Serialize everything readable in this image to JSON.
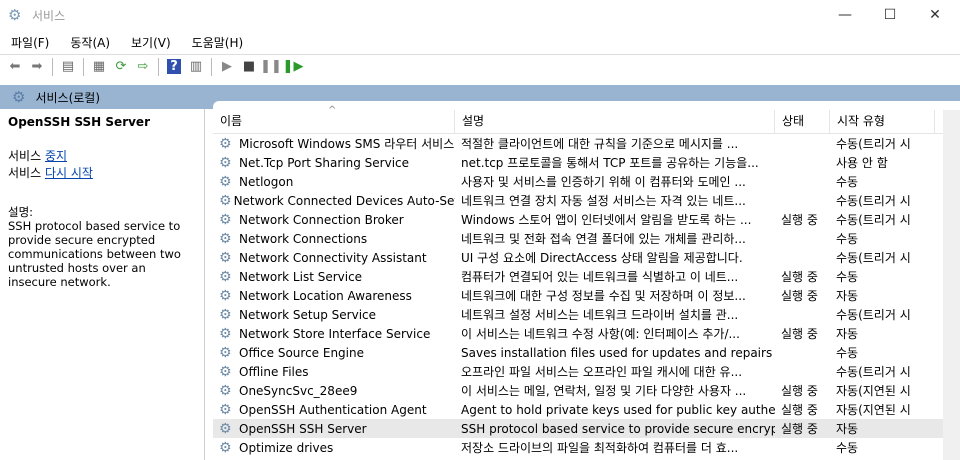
{
  "window": {
    "title": "서비스",
    "icon": "gear-icon"
  },
  "menu": [
    "파일(F)",
    "동작(A)",
    "보기(V)",
    "도움말(H)"
  ],
  "toolbar": [
    "back-icon",
    "forward-icon",
    "show-hide-tree-icon",
    "properties-icon",
    "refresh-icon",
    "export-icon",
    "help-icon",
    "console-icon",
    "start-icon",
    "stop-icon",
    "pause-icon",
    "restart-icon"
  ],
  "scope": {
    "title": "서비스(로컬)"
  },
  "detail": {
    "name": "OpenSSH SSH Server",
    "line1_prefix": "서비스 ",
    "stop_link": "중지",
    "line2_prefix": "서비스 ",
    "restart_link": "다시 시작",
    "desc_label": "설명:",
    "desc": "SSH protocol based service to provide secure encrypted communications between two untrusted hosts over an insecure network."
  },
  "table": {
    "columns": [
      "이름",
      "설명",
      "상태",
      "시작 유형"
    ],
    "rows": [
      {
        "name": "Microsoft Windows SMS 라우터 서비스",
        "desc": "적절한 클라이언트에 대한 규칙을 기준으로 메시지를 ...",
        "status": "",
        "startup": "수동(트리거 시"
      },
      {
        "name": "Net.Tcp Port Sharing Service",
        "desc": "net.tcp 프로토콜을 통해서 TCP 포트를 공유하는 기능을...",
        "status": "",
        "startup": "사용 안 함"
      },
      {
        "name": "Netlogon",
        "desc": "사용자 및 서비스를 인증하기 위해 이 컴퓨터와 도메인 ...",
        "status": "",
        "startup": "수동"
      },
      {
        "name": "Network Connected Devices Auto-Set",
        "desc": "네트워크 연결 장치 자동 설정 서비스는 자격 있는 네트...",
        "status": "",
        "startup": "수동(트리거 시"
      },
      {
        "name": "Network Connection Broker",
        "desc": "Windows 스토어 앱이 인터넷에서 알림을 받도록 하는 ...",
        "status": "실행 중",
        "startup": "수동(트리거 시"
      },
      {
        "name": "Network Connections",
        "desc": "네트워크 및 전화 접속 연결 폴더에 있는 개체를 관리하...",
        "status": "",
        "startup": "수동"
      },
      {
        "name": "Network Connectivity Assistant",
        "desc": "UI 구성 요소에 DirectAccess 상태 알림을 제공합니다.",
        "status": "",
        "startup": "수동(트리거 시"
      },
      {
        "name": "Network List Service",
        "desc": "컴퓨터가 연결되어 있는 네트워크를 식별하고 이 네트...",
        "status": "실행 중",
        "startup": "수동"
      },
      {
        "name": "Network Location Awareness",
        "desc": "네트워크에 대한 구성 정보를 수집 및 저장하며 이 정보...",
        "status": "실행 중",
        "startup": "자동"
      },
      {
        "name": "Network Setup Service",
        "desc": "네트워크 설정 서비스는 네트워크 드라이버 설치를 관...",
        "status": "",
        "startup": "수동(트리거 시"
      },
      {
        "name": "Network Store Interface Service",
        "desc": "이 서비스는 네트워크 수정 사항(예: 인터페이스 추가/...",
        "status": "실행 중",
        "startup": "자동"
      },
      {
        "name": "Office  Source Engine",
        "desc": "Saves installation files used for updates and repairs and...",
        "status": "",
        "startup": "수동"
      },
      {
        "name": "Offline Files",
        "desc": "오프라인 파일 서비스는 오프라인 파일 캐시에 대한 유...",
        "status": "",
        "startup": "수동(트리거 시"
      },
      {
        "name": "OneSyncSvc_28ee9",
        "desc": "이 서비스는 메일, 연락처, 일정 및 기타 다양한 사용자 ...",
        "status": "실행 중",
        "startup": "자동(지연된 시"
      },
      {
        "name": "OpenSSH Authentication Agent",
        "desc": "Agent to hold private keys used for public key authenti...",
        "status": "실행 중",
        "startup": "자동(지연된 시"
      },
      {
        "name": "OpenSSH SSH Server",
        "desc": "SSH protocol based service to provide secure encrypte...",
        "status": "실행 중",
        "startup": "자동",
        "selected": true
      },
      {
        "name": "Optimize drives",
        "desc": "저장소 드라이브의 파일을 최적화하여 컴퓨터를 더 효...",
        "status": "",
        "startup": "수동"
      }
    ]
  }
}
